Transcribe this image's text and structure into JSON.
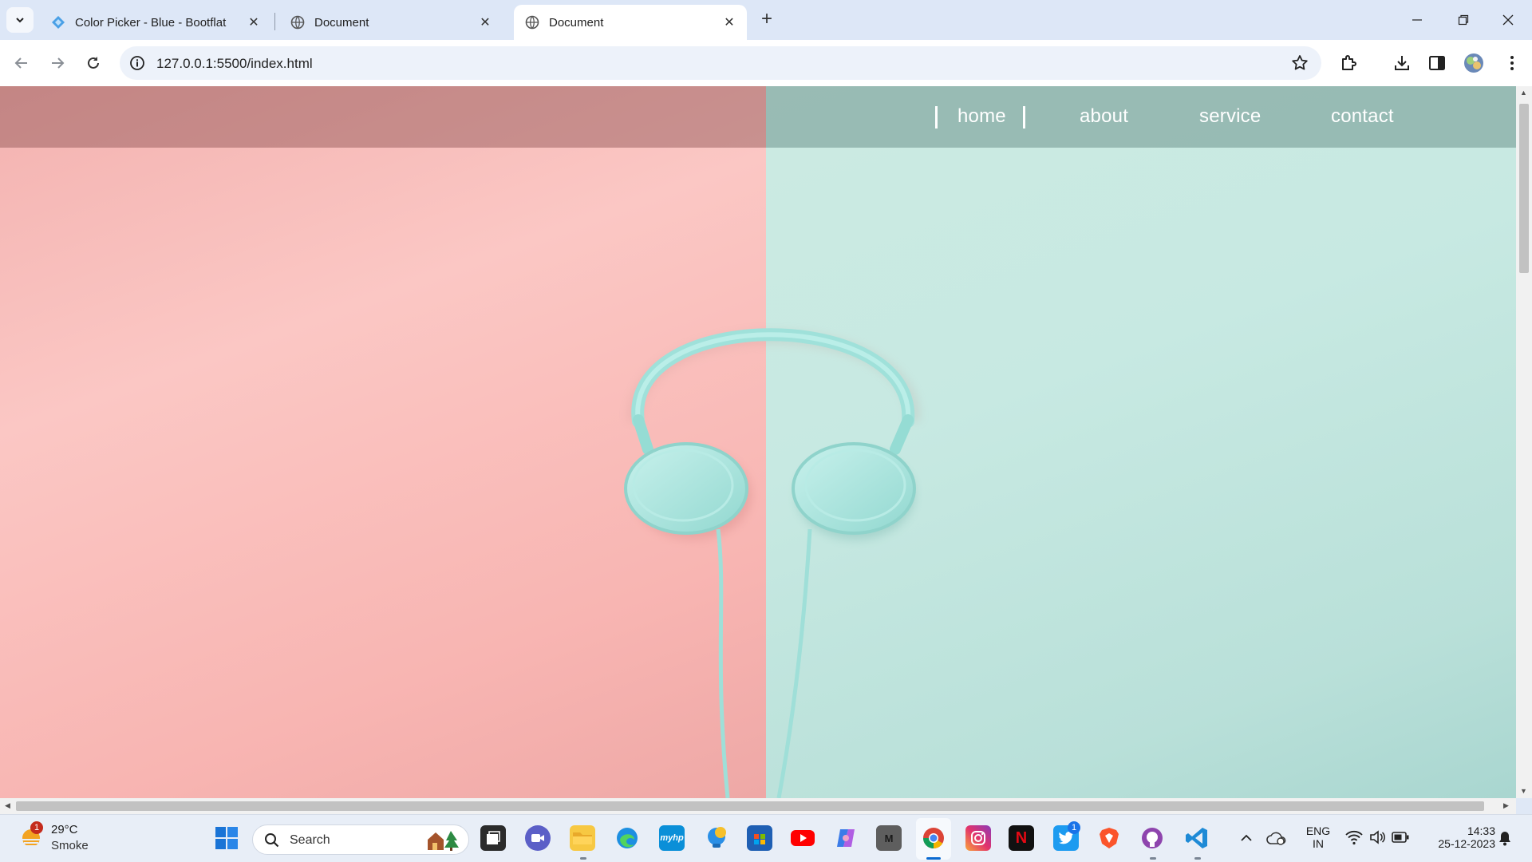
{
  "browser": {
    "tabs": [
      {
        "title": "Color Picker - Blue - Bootflat",
        "active": false
      },
      {
        "title": "Document",
        "active": false
      },
      {
        "title": "Document",
        "active": true
      }
    ],
    "url": "127.0.0.1:5500/index.html"
  },
  "page": {
    "nav": [
      "home",
      "about",
      "service",
      "contact"
    ],
    "colors": {
      "left_panel": "#fbc5c2",
      "right_panel": "#c7e9e2",
      "headphones": "#a9e4de"
    }
  },
  "taskbar": {
    "weather": {
      "temp": "29°C",
      "desc": "Smoke",
      "badge": "1"
    },
    "search_placeholder": "Search",
    "apps": [
      "start-icon",
      "task-view-icon",
      "meet-icon",
      "file-explorer-icon",
      "edge-icon",
      "myhp-icon",
      "tips-icon",
      "store-icon",
      "youtube-icon",
      "copilot-icon",
      "m-app-icon",
      "chrome-icon",
      "instagram-icon",
      "netflix-icon",
      "twitter-icon",
      "brave-icon",
      "github-icon",
      "vscode-icon"
    ],
    "myhp_label": "myhp",
    "m_label": "M",
    "netflix_label": "N",
    "twitter_badge": "1",
    "tray": {
      "lang": "ENG",
      "region": "IN",
      "time": "14:33",
      "date": "25-12-2023"
    }
  }
}
